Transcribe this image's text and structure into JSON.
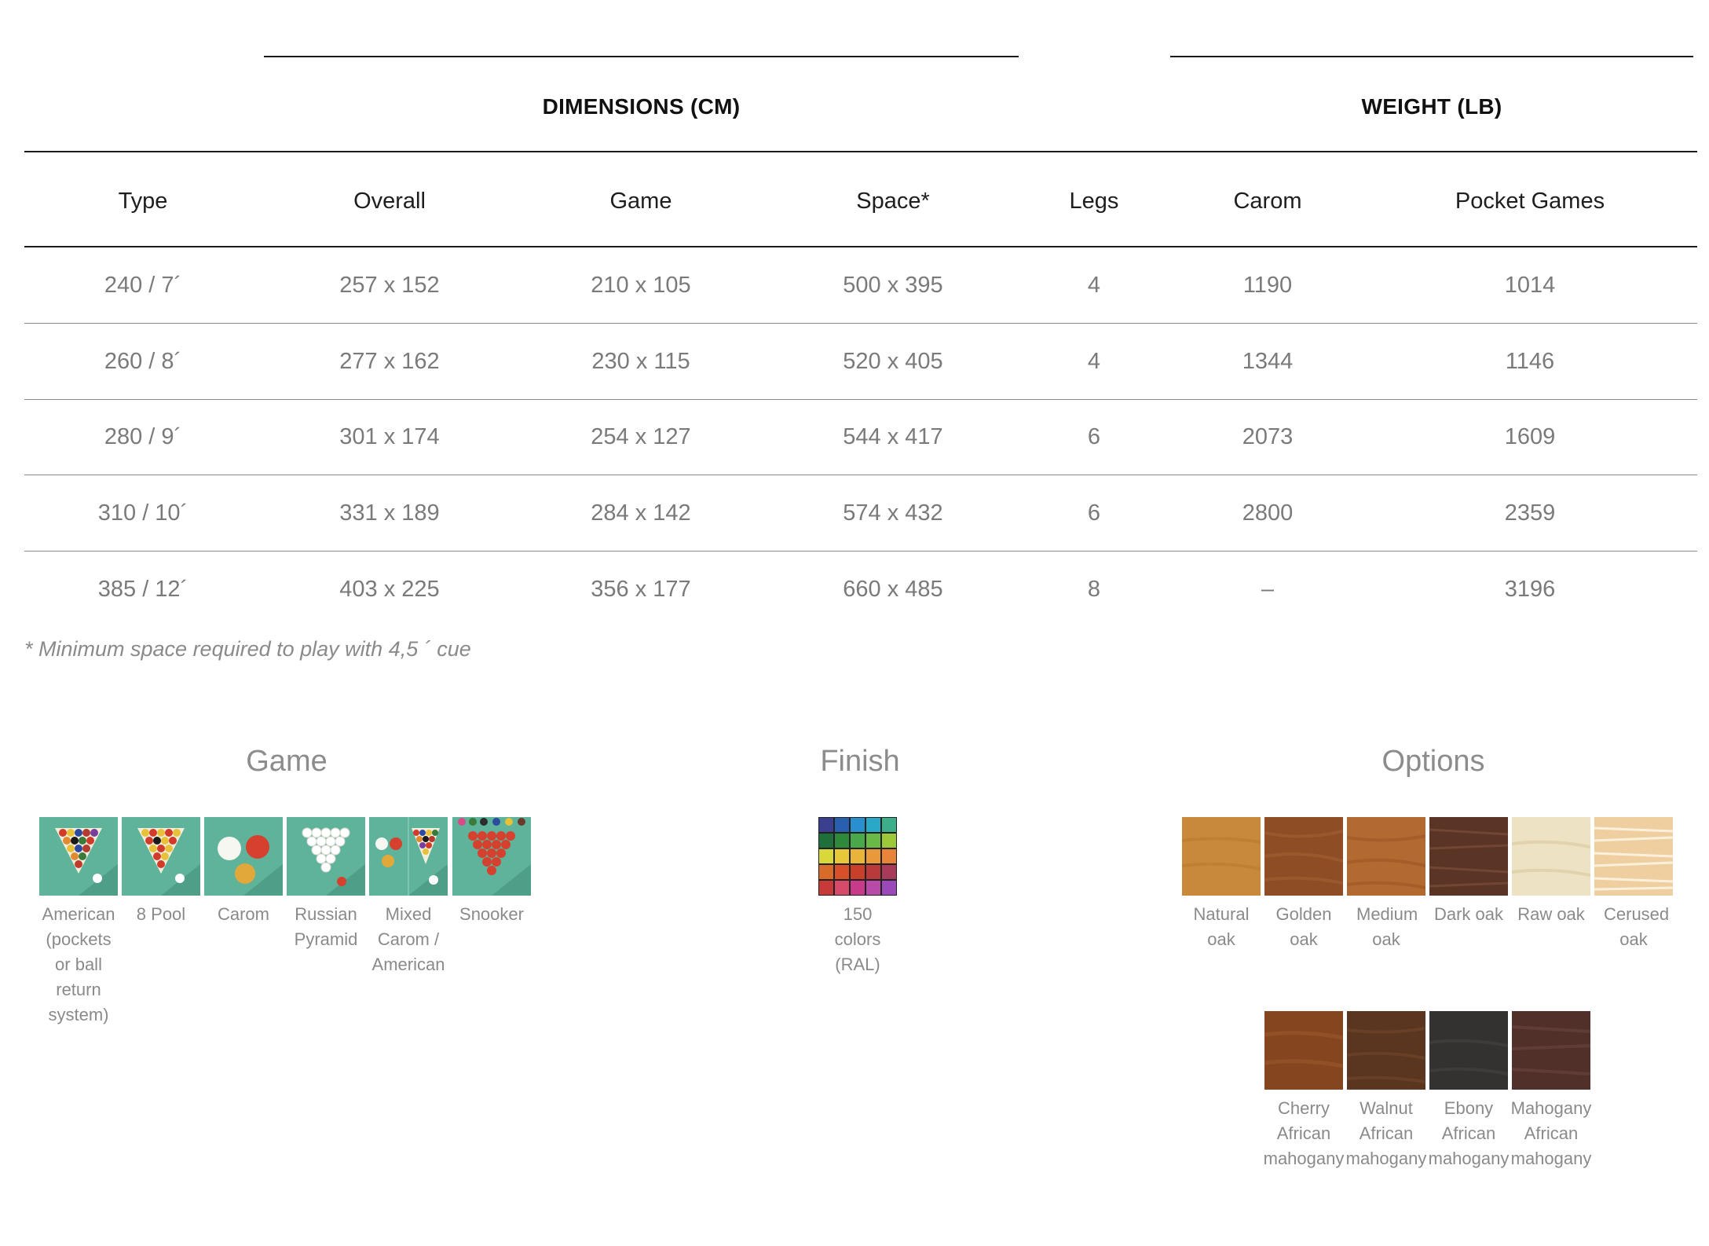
{
  "table": {
    "groups": {
      "dimensions": "DIMENSIONS (CM)",
      "weight": "WEIGHT (LB)"
    },
    "headers": [
      "Type",
      "Overall",
      "Game",
      "Space*",
      "Legs",
      "Carom",
      "Pocket Games"
    ],
    "rows": [
      [
        "240 / 7´",
        "257 x 152",
        "210 x 105",
        "500 x 395",
        "4",
        "1190",
        "1014"
      ],
      [
        "260 / 8´",
        "277 x 162",
        "230 x 115",
        "520 x 405",
        "4",
        "1344",
        "1146"
      ],
      [
        "280 / 9´",
        "301 x 174",
        "254 x 127",
        "544 x 417",
        "6",
        "2073",
        "1609"
      ],
      [
        "310 / 10´",
        "331 x 189",
        "284 x 142",
        "574 x 432",
        "6",
        "2800",
        "2359"
      ],
      [
        "385 / 12´",
        "403 x 225",
        "356 x 177",
        "660 x 485",
        "8",
        "–",
        "3196"
      ]
    ],
    "footnote": "* Minimum space required to play with 4,5 ´ cue"
  },
  "sections": {
    "game": {
      "title": "Game",
      "items": [
        {
          "label": "American (pockets or ball return system)",
          "icon": "american-billiards-icon"
        },
        {
          "label": "8 Pool",
          "icon": "eight-pool-icon"
        },
        {
          "label": "Carom",
          "icon": "carom-icon"
        },
        {
          "label": "Russian Pyramid",
          "icon": "russian-pyramid-icon"
        },
        {
          "label": "Mixed Carom / American",
          "icon": "mixed-carom-american-icon"
        },
        {
          "label": "Snooker",
          "icon": "snooker-icon"
        }
      ]
    },
    "finish": {
      "title": "Finish",
      "items": [
        {
          "label": "150 colors (RAL)",
          "icon": "ral-color-grid-icon"
        }
      ]
    },
    "options": {
      "title": "Options",
      "items": [
        {
          "label": "Natural oak",
          "color": "#c88a3a"
        },
        {
          "label": "Golden oak",
          "color": "#8e4d25"
        },
        {
          "label": "Medium oak",
          "color": "#b26a30"
        },
        {
          "label": "Dark oak",
          "color": "#5a3424"
        },
        {
          "label": "Raw oak",
          "color": "#ede3c4"
        },
        {
          "label": "Cerused oak",
          "color": "#efcfa0"
        },
        {
          "label": "Cherry African mahogany",
          "color": "#84451f"
        },
        {
          "label": "Walnut African mahogany",
          "color": "#5a3520"
        },
        {
          "label": "Ebony African mahogany",
          "color": "#343230"
        },
        {
          "label": "Mahogany African mahogany",
          "color": "#52302a"
        }
      ]
    }
  },
  "colors": {
    "felt": "#5fb39a",
    "text_dark": "#1e1e1e",
    "text_muted": "#7a7a7a"
  }
}
